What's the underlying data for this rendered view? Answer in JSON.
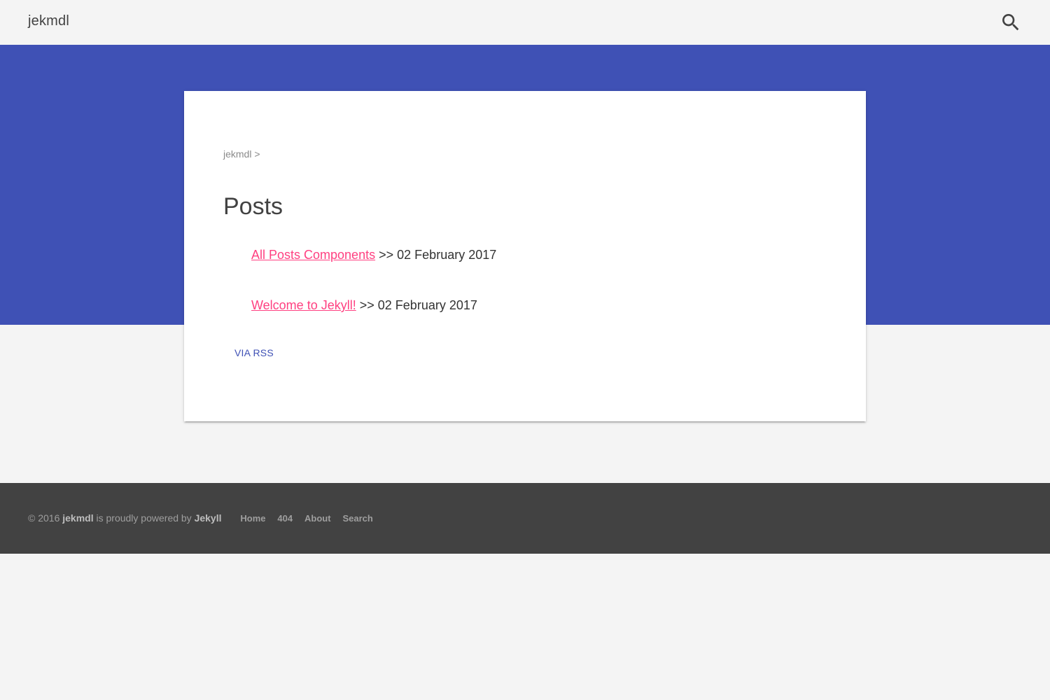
{
  "header": {
    "site_title": "jekmdl",
    "search_icon": "search-icon"
  },
  "colors": {
    "primary": "#3f51b5",
    "accent": "#ff4081",
    "footer_bg": "#424242",
    "page_bg": "#f4f4f4"
  },
  "main": {
    "breadcrumb": "jekmdl >",
    "title": "Posts",
    "posts": [
      {
        "title": "All Posts Components",
        "separator": ">>",
        "date": "02 February 2017"
      },
      {
        "title": "Welcome to Jekyll!",
        "separator": ">>",
        "date": "02 February 2017"
      }
    ],
    "rss_label": "VIA RSS"
  },
  "footer": {
    "copyright": "© 2016",
    "site_name": "jekmdl",
    "powered_text": "is proudly powered by",
    "engine": "Jekyll",
    "links": [
      "Home",
      "404",
      "About",
      "Search"
    ]
  }
}
